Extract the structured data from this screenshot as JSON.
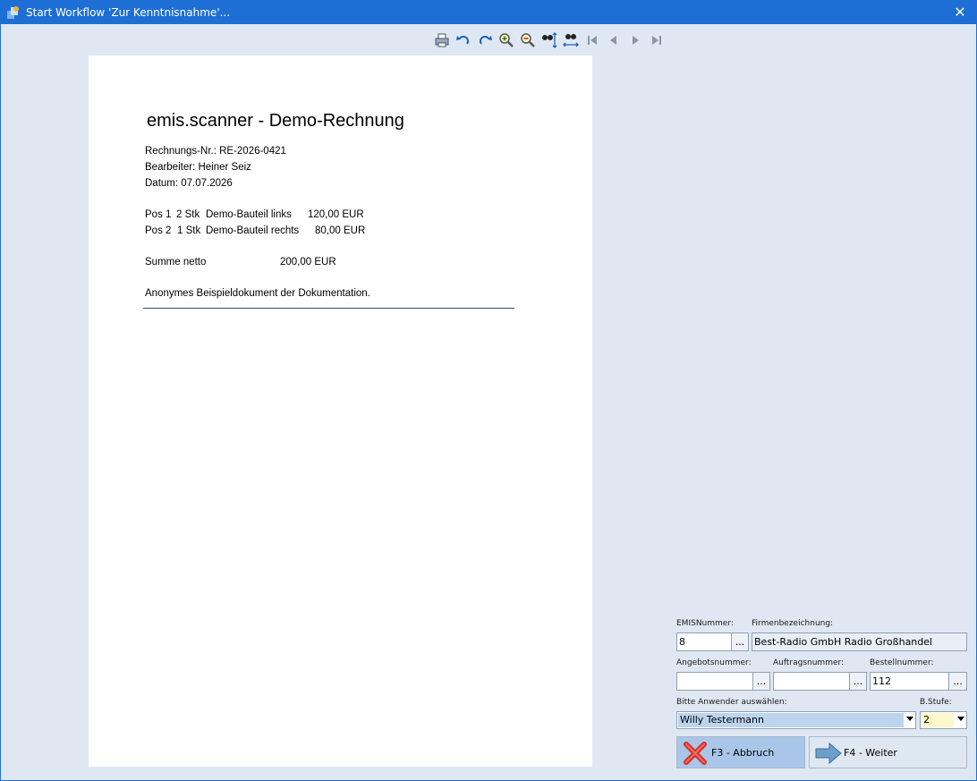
{
  "window": {
    "title": "Start Workflow 'Zur Kenntnisnahme'...",
    "close_label": "✕",
    "colors": {
      "titlebar": "#1d6fd6",
      "background": "#dfe8f2",
      "selection": "#bcd4ee"
    }
  },
  "toolbar": {
    "icons": [
      "print-icon",
      "rotate-left-icon",
      "rotate-right-icon",
      "zoom-in-icon",
      "zoom-out-icon",
      "fit-height-icon",
      "fit-width-icon",
      "first-page-icon",
      "previous-page-icon",
      "next-page-icon",
      "last-page-icon"
    ]
  },
  "document": {
    "heading": "emis.scanner - Demo-Rechnung",
    "invoice_no": "Rechnungs-Nr.: RE-2026-0421",
    "editor": "Bearbeiter: Heiner Seiz",
    "date": "Datum: 07.07.2026",
    "positions": [
      {
        "pos": "Pos 1",
        "qty": "2 Stk",
        "item": "Demo-Bauteil links",
        "price": "120,00 EUR"
      },
      {
        "pos": "Pos 2",
        "qty": "1 Stk",
        "item": "Demo-Bauteil rechts",
        "price": "80,00 EUR"
      }
    ],
    "sum_label": "Summe netto",
    "sum_value": "200,00 EUR",
    "footer": "Anonymes Beispieldokument der Dokumentation."
  },
  "form": {
    "emis_label": "EMISNummer:",
    "emis_value": "8",
    "firm_label": "Firmenbezeichnung:",
    "firm_value": "Best-Radio GmbH Radio Großhandel",
    "offer_label": "Angebotsnummer:",
    "offer_value": "",
    "order_label": "Auftragsnummer:",
    "order_value": "",
    "purchase_label": "Bestellnummer:",
    "purchase_value": "112",
    "dots_label": "...",
    "user_label": "Bitte Anwender auswählen:",
    "user_value": "Willy Testermann",
    "stage_label": "B.Stufe:",
    "stage_value": "2",
    "cancel_button": "F3 - Abbruch",
    "next_button": "F4 - Weiter"
  }
}
